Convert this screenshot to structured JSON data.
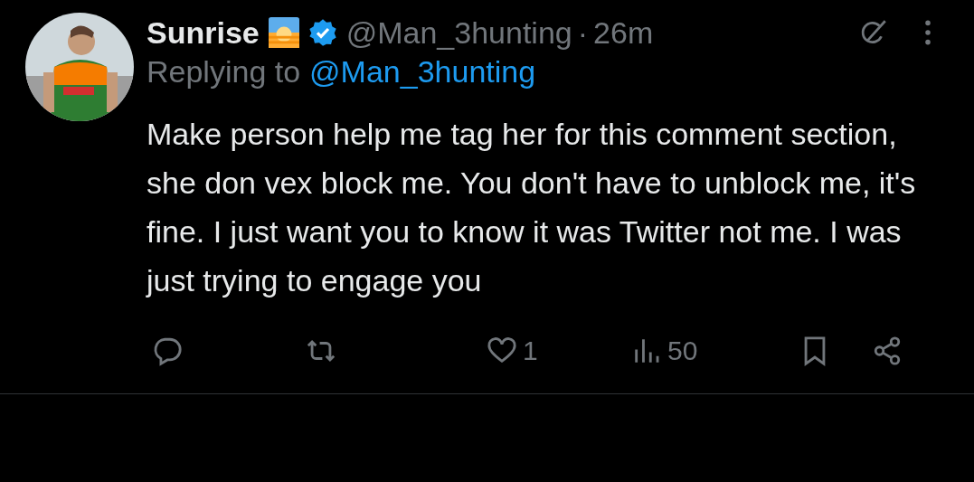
{
  "author": {
    "name": "Sunrise",
    "verified": true,
    "handle": "@Man_3hunting",
    "separator": "·",
    "time": "26m"
  },
  "reply": {
    "prefix": "Replying to",
    "mention": "@Man_3hunting"
  },
  "text": "Make person help me tag her for this comment section, she don vex block me. You don't have to unblock me, it's fine. I just want you to know it was Twitter not me. I was just trying to engage you",
  "actions": [
    {
      "kind": "reply"
    },
    {
      "kind": "repost"
    },
    {
      "kind": "like",
      "count": "1"
    },
    {
      "kind": "views",
      "count": "50"
    },
    {
      "kind": "bookmark"
    },
    {
      "kind": "share"
    }
  ]
}
